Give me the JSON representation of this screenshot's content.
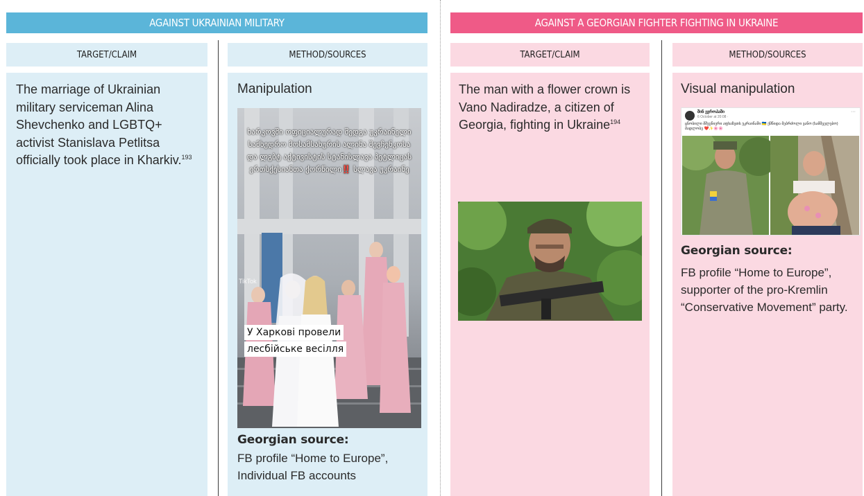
{
  "sections": {
    "ukrainian": {
      "title": "AGAINST UKRAINIAN MILITARY"
    },
    "georgian": {
      "title": "AGAINST A GEORGIAN FIGHTER FIGHTING IN UKRAINE"
    }
  },
  "col_headers": {
    "target": "TARGET/CLAIM",
    "method": "METHOD/SOURCES"
  },
  "left": {
    "claim_text": "The marriage of Ukrainian military serviceman Alina Shevchenko and LGBTQ+ activist Stanislava Petlitsa officially took place in Kharkiv.",
    "claim_ref": "193",
    "method": "Manipulation",
    "image": {
      "caption_georgian": "ხარკოვში ოფიციალურად შედგა უკრაინელი სამხედრო მოსამსახურის ალინა შევჩენკოსა და ლგბტ აქტივისტის სტანისლავა პეტლიცას ერთსქესიანთა ქორწილი‼️ სლავა უკრაინე",
      "caption_ukrainian_1": "У Харкові провели",
      "caption_ukrainian_2": "лесбійське весілля",
      "watermark": "TikTok"
    },
    "source_title": "Georgian source:",
    "source_body": "FB profile  “Home to Europe”, Individual FB accounts"
  },
  "right": {
    "claim_text": "The man with a flower crown is Vano Nadiradze, a citizen of Georgia, fighting in Ukraine",
    "claim_ref": "194",
    "method": "Visual manipulation",
    "post": {
      "author": "შინ ევროპაში",
      "date": "6 October at 20:08 · ",
      "text": "ცნობილი მშვენიერი აფხაზეთს უკრაინაში 🇺🇦 ქმნიდა მებრძოლი ვანო (სამშველებო) მადლობე ❤️✨🌸🌸"
    },
    "source_title": "Georgian source:",
    "source_body": "FB profile “Home to Europe”, supporter of the pro-Kremlin “Conservative Movement” party."
  },
  "colors": {
    "blue_band": "#5bb5d9",
    "blue_panel": "#ddeef6",
    "pink_band": "#ef5a87",
    "pink_panel": "#fbd9e2"
  }
}
